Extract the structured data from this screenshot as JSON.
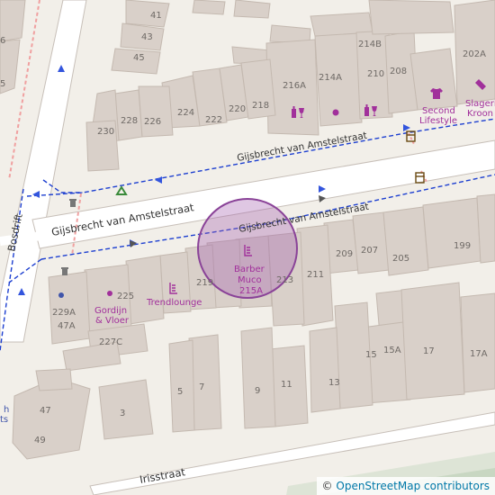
{
  "map": {
    "streets": {
      "gijsbrecht_main": "Gijsbrecht van Amstelstraat",
      "gijsbrecht_upper": "Gijsbrecht van Amstelstraat",
      "gijsbrecht_lower": "Gijsbrecht van Amstelstraat",
      "bosdrift": "Bosdrift",
      "irisstraat": "Irisstraat"
    },
    "house_numbers": {
      "n41": "41",
      "n43": "43",
      "n45": "45",
      "n6": "6",
      "n5": "5",
      "n214B": "214B",
      "n214A": "214A",
      "n216A": "216A",
      "n210": "210",
      "n208": "208",
      "n202A": "202A",
      "n230": "230",
      "n228": "228",
      "n226": "226",
      "n224": "224",
      "n222": "222",
      "n220": "220",
      "n218": "218",
      "n209": "209",
      "n207": "207",
      "n205": "205",
      "n199": "199",
      "n211": "211",
      "n213": "213",
      "n219": "219",
      "n225": "225",
      "n229A": "229A",
      "n47A": "47A",
      "n227C": "227C",
      "n15": "15",
      "n15A": "15A",
      "n17": "17",
      "n17A": "17A",
      "n13": "13",
      "n11": "11",
      "n9": "9",
      "n7": "7",
      "n5b": "5",
      "n3": "3",
      "n47": "47",
      "n49": "49"
    },
    "pois": {
      "barber_name": "Barber",
      "barber_name2": "Muco",
      "barber_number": "215A",
      "trendlounge": "Trendlounge",
      "gordijn1": "Gordijn",
      "gordijn2": "& Vloer",
      "second1": "Second",
      "second2": "Lifestyle",
      "slager1": "Slageri",
      "slager2": "Kroon",
      "edge1": "h",
      "edge2": "ts"
    },
    "icons": [
      "hairdresser-icon",
      "wine-glass-icon",
      "bottle-icon",
      "shop-dot-icon",
      "clothes-icon",
      "butcher-icon",
      "recycling-icon",
      "waste-basket-icon",
      "bus-stop-icon"
    ],
    "highlight": {
      "color": "#a35fae",
      "label": "Barber Muco 215A"
    },
    "colors": {
      "background": "#f2efe9",
      "building": "#d9d0c9",
      "road": "#ffffff",
      "footway": "#1d3fd0",
      "poi": "#a1309b"
    }
  },
  "attribution": {
    "symbol": "©",
    "text": "OpenStreetMap contributors"
  }
}
